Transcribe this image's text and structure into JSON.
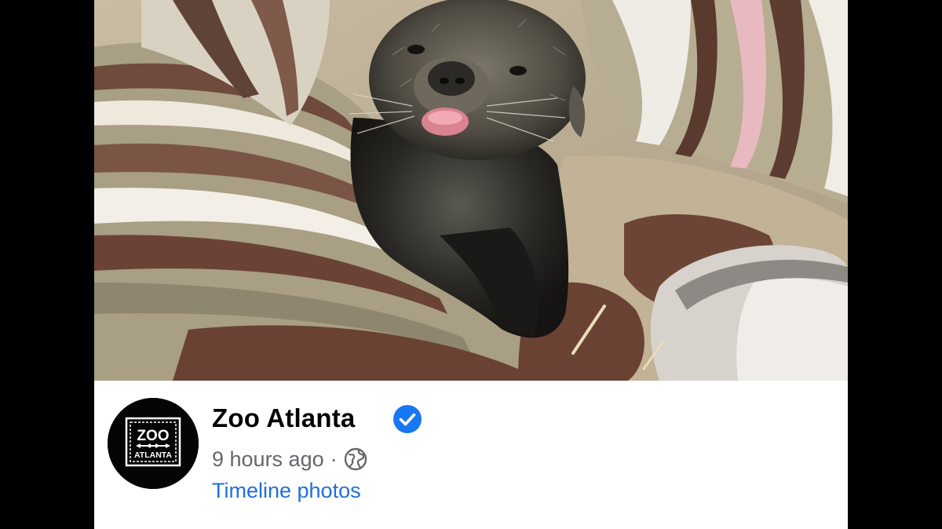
{
  "post": {
    "page_name": "Zoo Atlanta",
    "verified_icon": "verified-badge-icon",
    "timestamp": "9 hours ago",
    "separator": "·",
    "audience_icon": "globe-icon",
    "album_link": "Timeline photos",
    "avatar": {
      "logo_text_top": "ZOO",
      "logo_text_bottom": "ATLANTA"
    },
    "photo": {
      "subject": "baby binturong on striped blanket"
    }
  },
  "colors": {
    "link": "#216fdb",
    "verified": "#1877f2",
    "meta_text": "#65676b",
    "name_text": "#050505"
  }
}
